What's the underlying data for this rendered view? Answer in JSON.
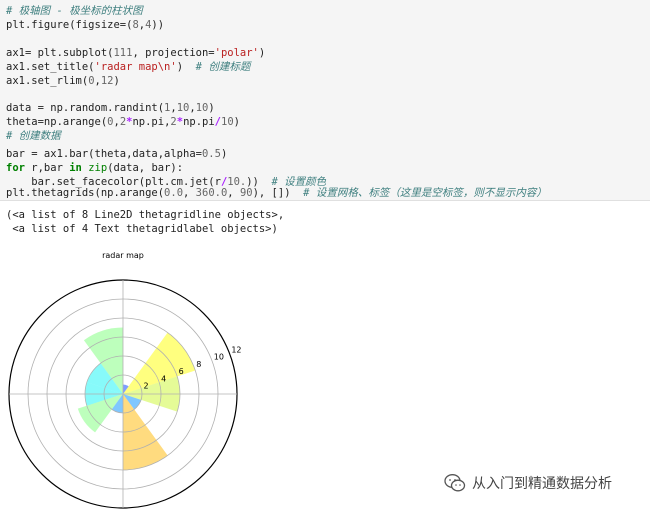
{
  "code": {
    "l1": "# 极轴图 - 极坐标的柱状图",
    "l2a": "plt.figure(figsize=(",
    "l2n1": "8",
    "l2b": ",",
    "l2n2": "4",
    "l2c": "))",
    "l4a": "ax1= plt.subplot(",
    "l4n": "111",
    "l4b": ", projection=",
    "l4s": "'polar'",
    "l4c": ")",
    "l5a": "ax1.set_title(",
    "l5s": "'radar map\\n'",
    "l5b": ")  ",
    "l5c": "# 创建标题",
    "l6a": "ax1.set_rlim(",
    "l6n1": "0",
    "l6b": ",",
    "l6n2": "12",
    "l6c": ")",
    "l8a": "data = np.random.randint(",
    "l8n1": "1",
    "l8b": ",",
    "l8n2": "10",
    "l8c": ",",
    "l8n3": "10",
    "l8d": ")",
    "l9a": "theta=np.arange(",
    "l9n1": "0",
    "l9b": ",",
    "l9n2": "2",
    "l9op1": "*",
    "l9c": "np.pi,",
    "l9n3": "2",
    "l9op2": "*",
    "l9d": "np.pi",
    "l9op3": "/",
    "l9n4": "10",
    "l9e": ")",
    "l10": "# 创建数据",
    "l12a": "bar = ax1.bar(theta,data,alpha=",
    "l12n": "0.5",
    "l12b": ")",
    "l13k1": "for",
    "l13a": " r,bar ",
    "l13k2": "in",
    "l13b": " ",
    "l13f": "zip",
    "l13c": "(data, bar):",
    "l14a": "    bar.set_facecolor(plt.cm.jet(r",
    "l14op": "/",
    "l14n": "10.",
    "l14b": "))  ",
    "l14c": "# 设置颜色",
    "l15a": "plt.thetagrids(np.arange(",
    "l15n1": "0.0",
    "l15b": ", ",
    "l15n2": "360.0",
    "l15c": ", ",
    "l15n3": "90",
    "l15d": "), [])  ",
    "l15e": "# 设置网格、标签（这里是空标签，则不显示内容）"
  },
  "output": {
    "line1": "(<a list of 8 Line2D thetagridline objects>,",
    "line2": " <a list of 4 Text thetagridlabel objects>)"
  },
  "chart_data": {
    "type": "bar",
    "projection": "polar",
    "title": "radar map",
    "rlim": [
      0,
      12
    ],
    "r_ticks": [
      2,
      4,
      6,
      8,
      10,
      12
    ],
    "theta_grid_deg": [
      0,
      90,
      180,
      270
    ],
    "theta_labels_shown": false,
    "bar_alpha": 0.5,
    "colormap": "jet",
    "theta_deg": [
      0,
      36,
      72,
      108,
      144,
      180,
      216,
      252,
      288,
      324
    ],
    "values": [
      6,
      8,
      1,
      7,
      4,
      4,
      5,
      2,
      8,
      2
    ],
    "colors": [
      "#ccf830",
      "#ffff00",
      "#0040ff",
      "#7cff79",
      "#0ff5f5",
      "#0ff5f5",
      "#7cff79",
      "#0090ff",
      "#ffb800",
      "#0090ff"
    ]
  },
  "watermark": {
    "icon": "wechat-icon",
    "text": "从入门到精通数据分析"
  }
}
